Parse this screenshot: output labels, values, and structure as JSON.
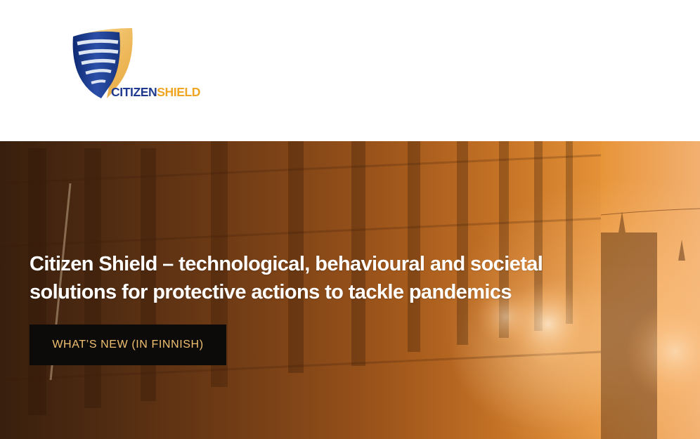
{
  "header": {
    "logo": {
      "text_part_a": "CITIZEN",
      "text_part_b": "SHIELD"
    }
  },
  "hero": {
    "title": "Citizen Shield – technological, behavioural and societal solutions for protective actions to tackle pandemics",
    "button_label": "WHAT’S NEW (IN FINNISH)"
  },
  "colors": {
    "logo_blue": "#1f3a8f",
    "logo_gold": "#f0a623",
    "button_bg": "#0d0b0a",
    "button_text": "#f0c070",
    "hero_title": "#ffffff"
  },
  "icons": {
    "logo": "shield-icon"
  }
}
